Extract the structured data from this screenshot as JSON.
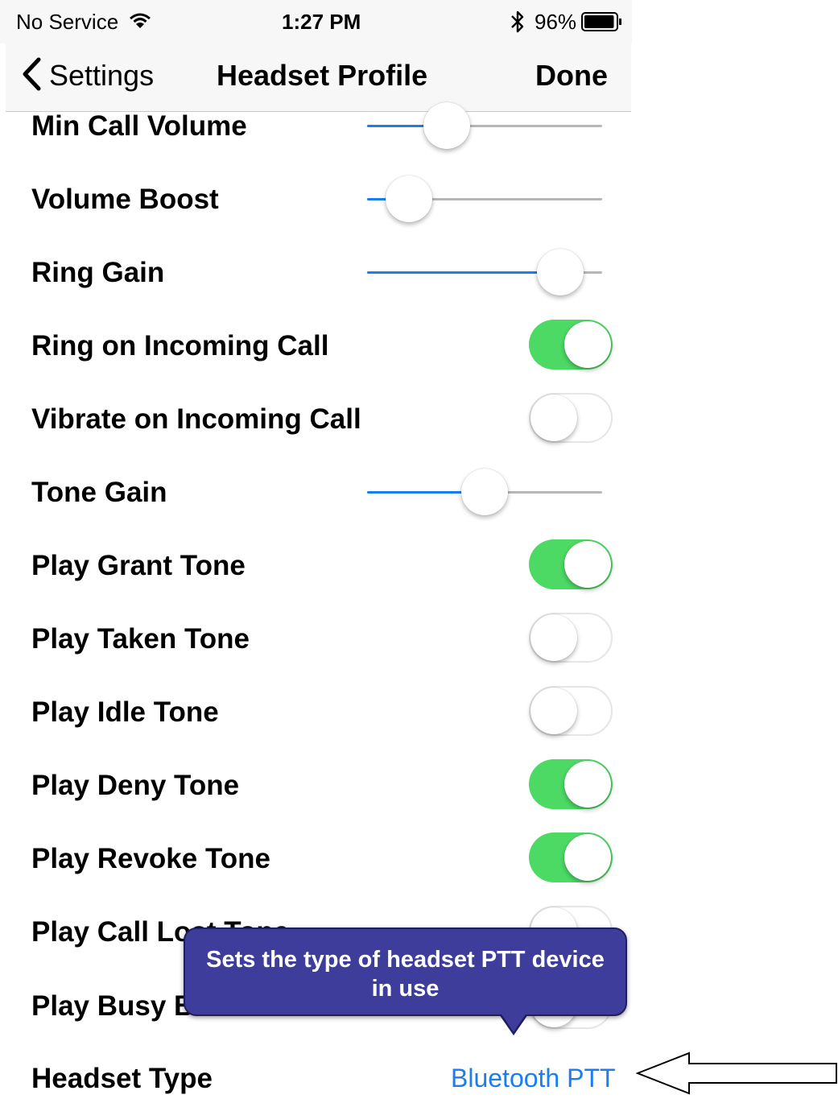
{
  "status_bar": {
    "carrier": "No Service",
    "time": "1:27 PM",
    "battery": "96%",
    "battery_level": 0.96,
    "icons": [
      "wifi-icon",
      "bluetooth-icon",
      "battery-icon"
    ]
  },
  "nav": {
    "back_label": "Settings",
    "title": "Headset Profile",
    "done_label": "Done"
  },
  "rows": [
    {
      "label": "Min Call Volume",
      "type": "slider",
      "value": 0.3
    },
    {
      "label": "Volume Boost",
      "type": "slider",
      "value": 0.1
    },
    {
      "label": "Ring Gain",
      "type": "slider",
      "value": 0.9
    },
    {
      "label": "Ring on Incoming Call",
      "type": "toggle",
      "on": true
    },
    {
      "label": "Vibrate on Incoming Call",
      "type": "toggle",
      "on": false
    },
    {
      "label": "Tone Gain",
      "type": "slider",
      "value": 0.5
    },
    {
      "label": "Play Grant Tone",
      "type": "toggle",
      "on": true
    },
    {
      "label": "Play Taken Tone",
      "type": "toggle",
      "on": false
    },
    {
      "label": "Play Idle Tone",
      "type": "toggle",
      "on": false
    },
    {
      "label": "Play Deny Tone",
      "type": "toggle",
      "on": true
    },
    {
      "label": "Play Revoke Tone",
      "type": "toggle",
      "on": true
    },
    {
      "label": "Play Call Lost Tone",
      "type": "toggle",
      "on": false
    },
    {
      "label": "Play Busy B",
      "type": "toggle",
      "on": false
    },
    {
      "label": "Headset Type",
      "type": "value",
      "value": "Bluetooth PTT"
    }
  ],
  "tooltip": {
    "line1": "Sets the type of headset PTT device",
    "line2": "in use"
  },
  "colors": {
    "accent": "#1a7ef0",
    "toggle_on": "#4cd964",
    "tooltip_bg": "#3e3d9c"
  }
}
